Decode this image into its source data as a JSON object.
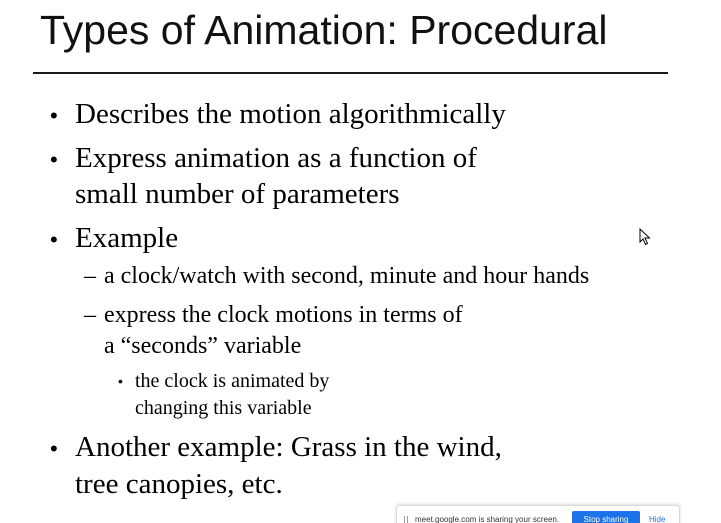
{
  "slide": {
    "title": "Types of Animation: Procedural",
    "bullets": [
      {
        "text": "Describes the motion algorithmically"
      },
      {
        "lines": [
          "Express animation as a function of",
          "small number of parameters"
        ]
      },
      {
        "text": "Example",
        "sub": [
          {
            "text": "a clock/watch with second, minute and hour hands"
          },
          {
            "lines": [
              "express the clock motions in terms of",
              "a “seconds” variable"
            ],
            "sub": {
              "lines": [
                "the clock is animated by",
                "changing this variable"
              ]
            }
          }
        ]
      },
      {
        "lines": [
          "Another example: Grass in the wind,",
          "tree canopies, etc."
        ]
      }
    ],
    "bullet_glyph": "•",
    "dash_glyph": "–"
  },
  "share_bar": {
    "message": "meet.google.com is sharing your screen.",
    "stop_label": "Stop sharing",
    "hide_label": "Hide",
    "accent_color": "#1a73e8"
  },
  "cursor": {
    "icon": "mouse-pointer-icon"
  }
}
